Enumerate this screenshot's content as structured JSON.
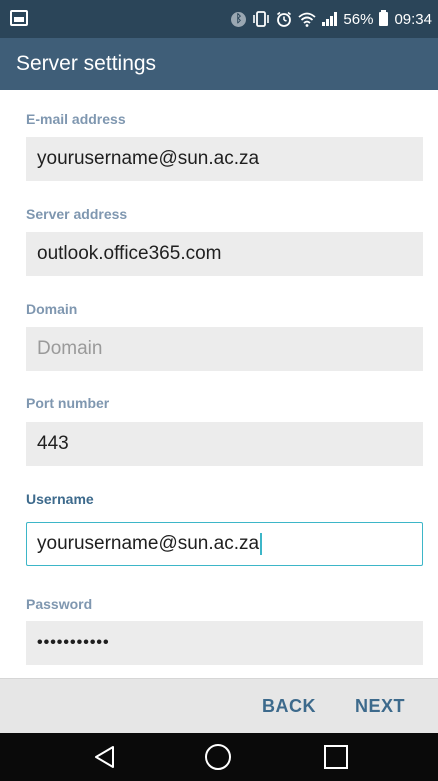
{
  "status_bar": {
    "battery_text": "56%",
    "time": "09:34",
    "icons": [
      "gallery-icon",
      "bluetooth-icon",
      "vibrate-icon",
      "alarm-icon",
      "wifi-icon",
      "signal-icon",
      "battery-icon"
    ]
  },
  "app_bar": {
    "title": "Server settings"
  },
  "form": {
    "email": {
      "label": "E-mail address",
      "value": "yourusername@sun.ac.za"
    },
    "server": {
      "label": "Server address",
      "value": "outlook.office365.com"
    },
    "domain": {
      "label": "Domain",
      "placeholder": "Domain"
    },
    "port": {
      "label": "Port number",
      "value": "443"
    },
    "username": {
      "label": "Username",
      "value": "yourusername@sun.ac.za"
    },
    "password": {
      "label": "Password",
      "value": "•••••••••••"
    }
  },
  "buttons": {
    "back": "BACK",
    "next": "NEXT"
  },
  "colors": {
    "status_bar": "#2b4559",
    "app_bar": "#3f5e78",
    "label": "#7f97b0",
    "accent": "#3d6a8c",
    "focus_border": "#3db6c8",
    "field_bg": "#ececec"
  }
}
